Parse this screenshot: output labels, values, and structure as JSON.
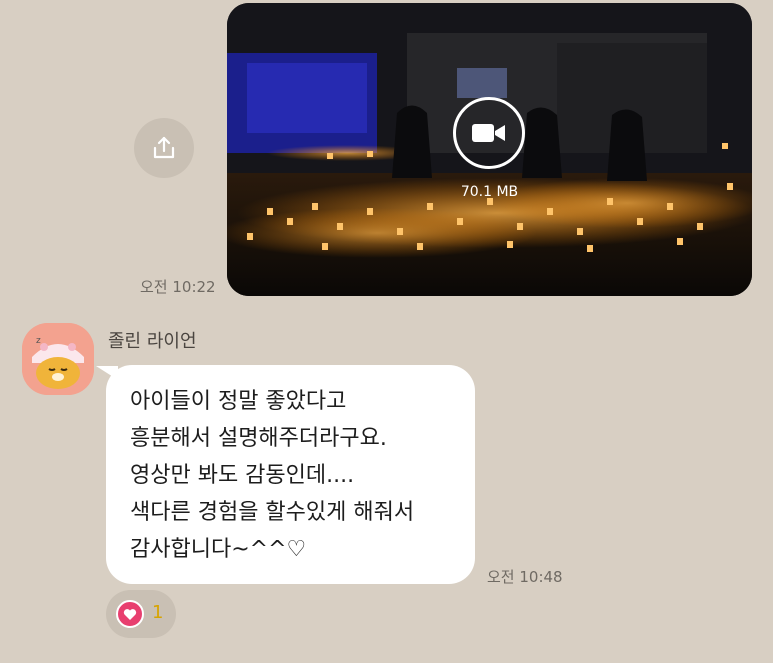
{
  "message_out": {
    "video_size": "70.1 MB",
    "time": "오전 10:22",
    "share_icon": "share-upload-icon",
    "play_icon": "video-camera-icon"
  },
  "message_in": {
    "sender": "졸린 라이언",
    "lines": [
      "아이들이 정말 좋았다고",
      "흥분해서 설명해주더라구요.",
      "영상만 봐도 감동인데....",
      "색다른 경험을 할수있게 해줘서",
      "감사합니다~^^♡"
    ],
    "time": "오전 10:48",
    "avatar_icon": "sleepy-ryan-avatar-icon"
  },
  "reaction": {
    "icon": "heart-icon",
    "count": "1",
    "color": "#e83f6f"
  },
  "colors": {
    "background": "#d8cfc3",
    "bubble": "#ffffff",
    "count": "#d7a400"
  }
}
